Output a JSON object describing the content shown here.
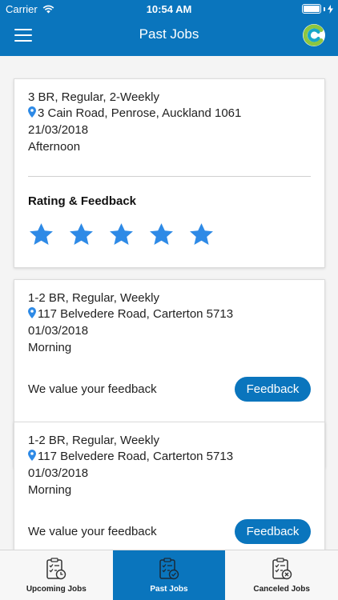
{
  "status_bar": {
    "carrier": "Carrier",
    "time": "10:54 AM"
  },
  "header": {
    "title": "Past Jobs",
    "menu_icon": "hamburger-menu-icon",
    "logo": "c-logo"
  },
  "jobs": [
    {
      "summary": "3 BR, Regular, 2-Weekly",
      "address": "3 Cain Road, Penrose, Auckland 1061",
      "date": "21/03/2018",
      "time_slot": "Afternoon",
      "rating_label": "Rating & Feedback",
      "rating": 5,
      "rating_max": 5
    },
    {
      "summary": "1-2 BR, Regular, Weekly",
      "address": "117 Belvedere Road, Carterton 5713",
      "date": "01/03/2018",
      "time_slot": "Morning",
      "feedback_prompt": "We value your feedback",
      "feedback_button": "Feedback"
    },
    {
      "summary": "1-2 BR, Regular, Weekly",
      "address": "117 Belvedere Road, Carterton 5713",
      "date": "01/03/2018",
      "time_slot": "Morning",
      "feedback_prompt": "We value your feedback",
      "feedback_button": "Feedback"
    }
  ],
  "tabs": [
    {
      "label": "Upcoming Jobs",
      "icon": "clipboard-clock-icon",
      "active": false
    },
    {
      "label": "Past Jobs",
      "icon": "clipboard-check-icon",
      "active": true
    },
    {
      "label": "Canceled Jobs",
      "icon": "clipboard-cancel-icon",
      "active": false
    }
  ],
  "colors": {
    "primary": "#0a75bd",
    "star": "#2e8ae6",
    "logo_green": "#8dc63f",
    "logo_teal": "#19a7c9"
  }
}
